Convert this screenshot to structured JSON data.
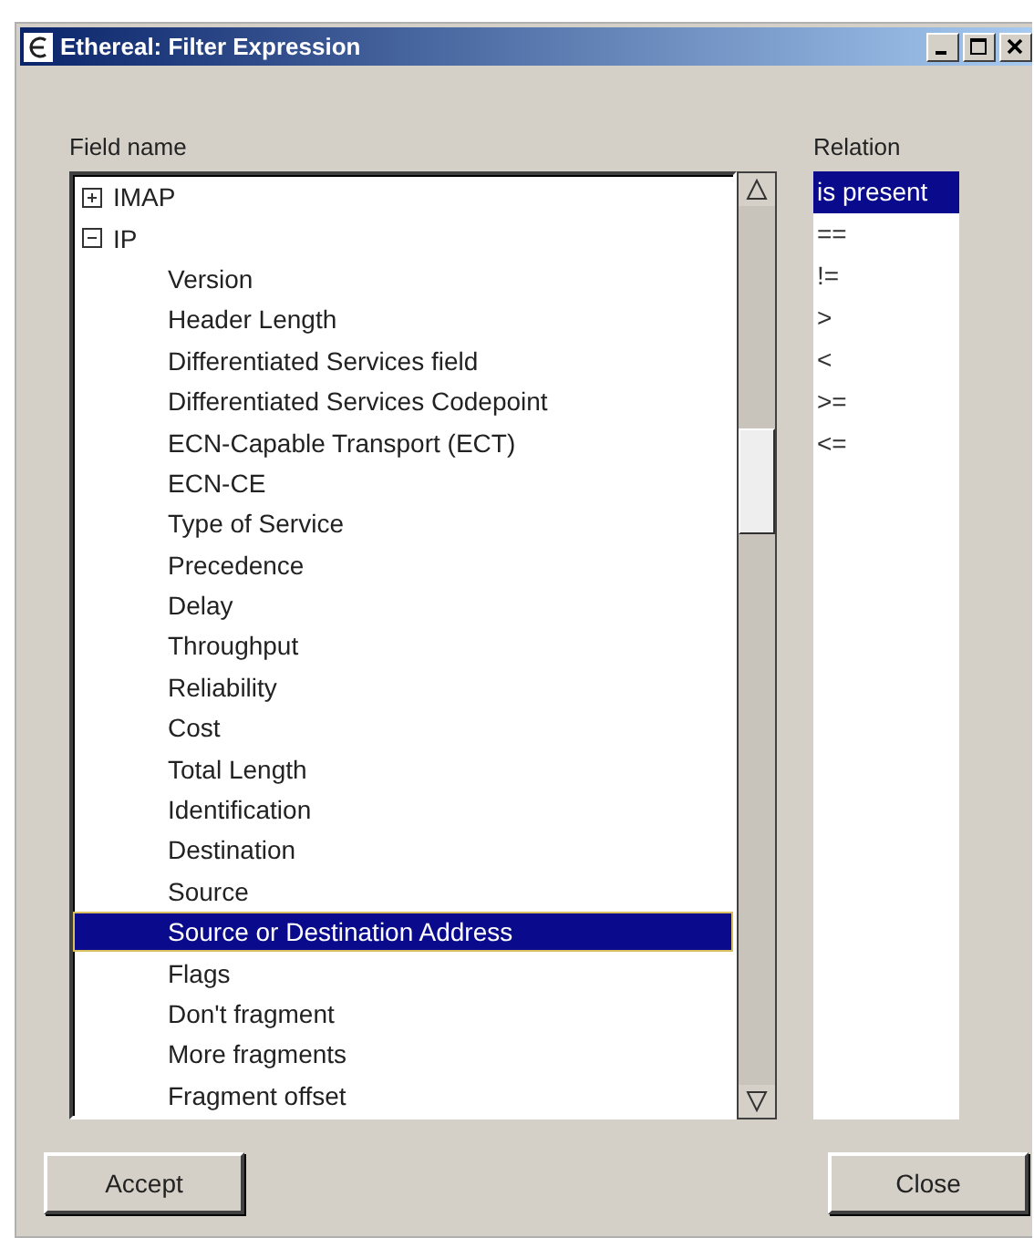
{
  "window": {
    "title": "Ethereal: Filter Expression"
  },
  "field_name": {
    "label": "Field name",
    "tree": [
      {
        "label": "IMAP",
        "expanded": false,
        "selected": false
      },
      {
        "label": "IP",
        "expanded": true,
        "selected": false,
        "children": [
          {
            "label": "Version",
            "selected": false
          },
          {
            "label": "Header Length",
            "selected": false
          },
          {
            "label": "Differentiated Services field",
            "selected": false
          },
          {
            "label": "Differentiated Services Codepoint",
            "selected": false
          },
          {
            "label": "ECN-Capable Transport (ECT)",
            "selected": false
          },
          {
            "label": "ECN-CE",
            "selected": false
          },
          {
            "label": "Type of Service",
            "selected": false
          },
          {
            "label": "Precedence",
            "selected": false
          },
          {
            "label": "Delay",
            "selected": false
          },
          {
            "label": "Throughput",
            "selected": false
          },
          {
            "label": "Reliability",
            "selected": false
          },
          {
            "label": "Cost",
            "selected": false
          },
          {
            "label": "Total Length",
            "selected": false
          },
          {
            "label": "Identification",
            "selected": false
          },
          {
            "label": "Destination",
            "selected": false
          },
          {
            "label": "Source",
            "selected": false
          },
          {
            "label": "Source or Destination Address",
            "selected": true
          },
          {
            "label": "Flags",
            "selected": false
          },
          {
            "label": "Don't fragment",
            "selected": false
          },
          {
            "label": "More fragments",
            "selected": false
          },
          {
            "label": "Fragment offset",
            "selected": false
          }
        ]
      }
    ]
  },
  "relation": {
    "label": "Relation",
    "items": [
      {
        "label": "is present",
        "selected": true
      },
      {
        "label": "==",
        "selected": false
      },
      {
        "label": "!=",
        "selected": false
      },
      {
        "label": ">",
        "selected": false
      },
      {
        "label": "<",
        "selected": false
      },
      {
        "label": ">=",
        "selected": false
      },
      {
        "label": "<=",
        "selected": false
      }
    ]
  },
  "buttons": [
    {
      "label": "Accept"
    },
    {
      "label": "Close"
    }
  ]
}
